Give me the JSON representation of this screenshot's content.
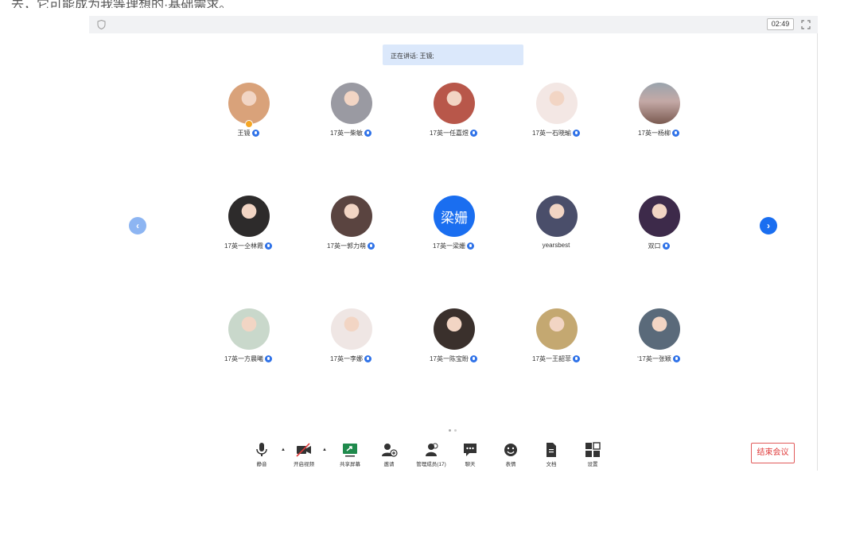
{
  "top_partial_text": "去，它可能成为我等理想的·基础需求。",
  "titlebar": {
    "timer": "02:49"
  },
  "speaker_banner": "正在讲话: 王镜;",
  "participants": [
    {
      "name": "王镜",
      "avatar": "photo-baby",
      "color": "#d9a27a",
      "host": true
    },
    {
      "name": "17英一柴敏",
      "avatar": "photo-person",
      "color": "#9a9aa2"
    },
    {
      "name": "17英一任嘉煜",
      "avatar": "photo-person",
      "color": "#b8574a"
    },
    {
      "name": "17英一石晓瑜",
      "avatar": "cartoon-girl",
      "color": "#f3e7e4"
    },
    {
      "name": "17英一杨柳",
      "avatar": "photo-landscape",
      "color": "#8a7a78"
    },
    {
      "name": "17英一仝林霞",
      "avatar": "photo-person",
      "color": "#2d2b2b"
    },
    {
      "name": "17英一郭力萌",
      "avatar": "photo-person",
      "color": "#5a4440"
    },
    {
      "name": "17英一梁姗",
      "avatar": "text",
      "avatar_text": "梁姗",
      "color": "#1a6ef0"
    },
    {
      "name": "yearsbest",
      "avatar": "cartoon",
      "color": "#4a4e6a",
      "no_mic": true
    },
    {
      "name": "双口",
      "avatar": "cartoon",
      "color": "#3d2a4a"
    },
    {
      "name": "17英一方晨曦",
      "avatar": "illustration",
      "color": "#c9d8cb"
    },
    {
      "name": "17英一李娜",
      "avatar": "cartoon-girl",
      "color": "#efe6e4"
    },
    {
      "name": "17英一陈宝盼",
      "avatar": "photo-person",
      "color": "#3a302c"
    },
    {
      "name": "17英一王韶菲",
      "avatar": "cartoon",
      "color": "#c4a871"
    },
    {
      "name": "‘17英一张颖",
      "avatar": "photo-person",
      "color": "#5a6a7a"
    }
  ],
  "toolbar": [
    {
      "label": "静音",
      "icon": "microphone-icon"
    },
    {
      "label": "开启视频",
      "icon": "video-off-icon"
    },
    {
      "label": "共享屏幕",
      "icon": "share-screen-icon"
    },
    {
      "label": "邀请",
      "icon": "invite-icon"
    },
    {
      "label": "管理成员(17)",
      "icon": "members-icon"
    },
    {
      "label": "聊天",
      "icon": "chat-icon"
    },
    {
      "label": "表情",
      "icon": "emoji-icon"
    },
    {
      "label": "文档",
      "icon": "document-icon"
    },
    {
      "label": "设置",
      "icon": "settings-icon"
    }
  ],
  "end_button": "结束会议",
  "colors": {
    "accent": "#1a6ef0",
    "danger": "#e03c3c",
    "banner_bg": "#dbe8fb"
  }
}
